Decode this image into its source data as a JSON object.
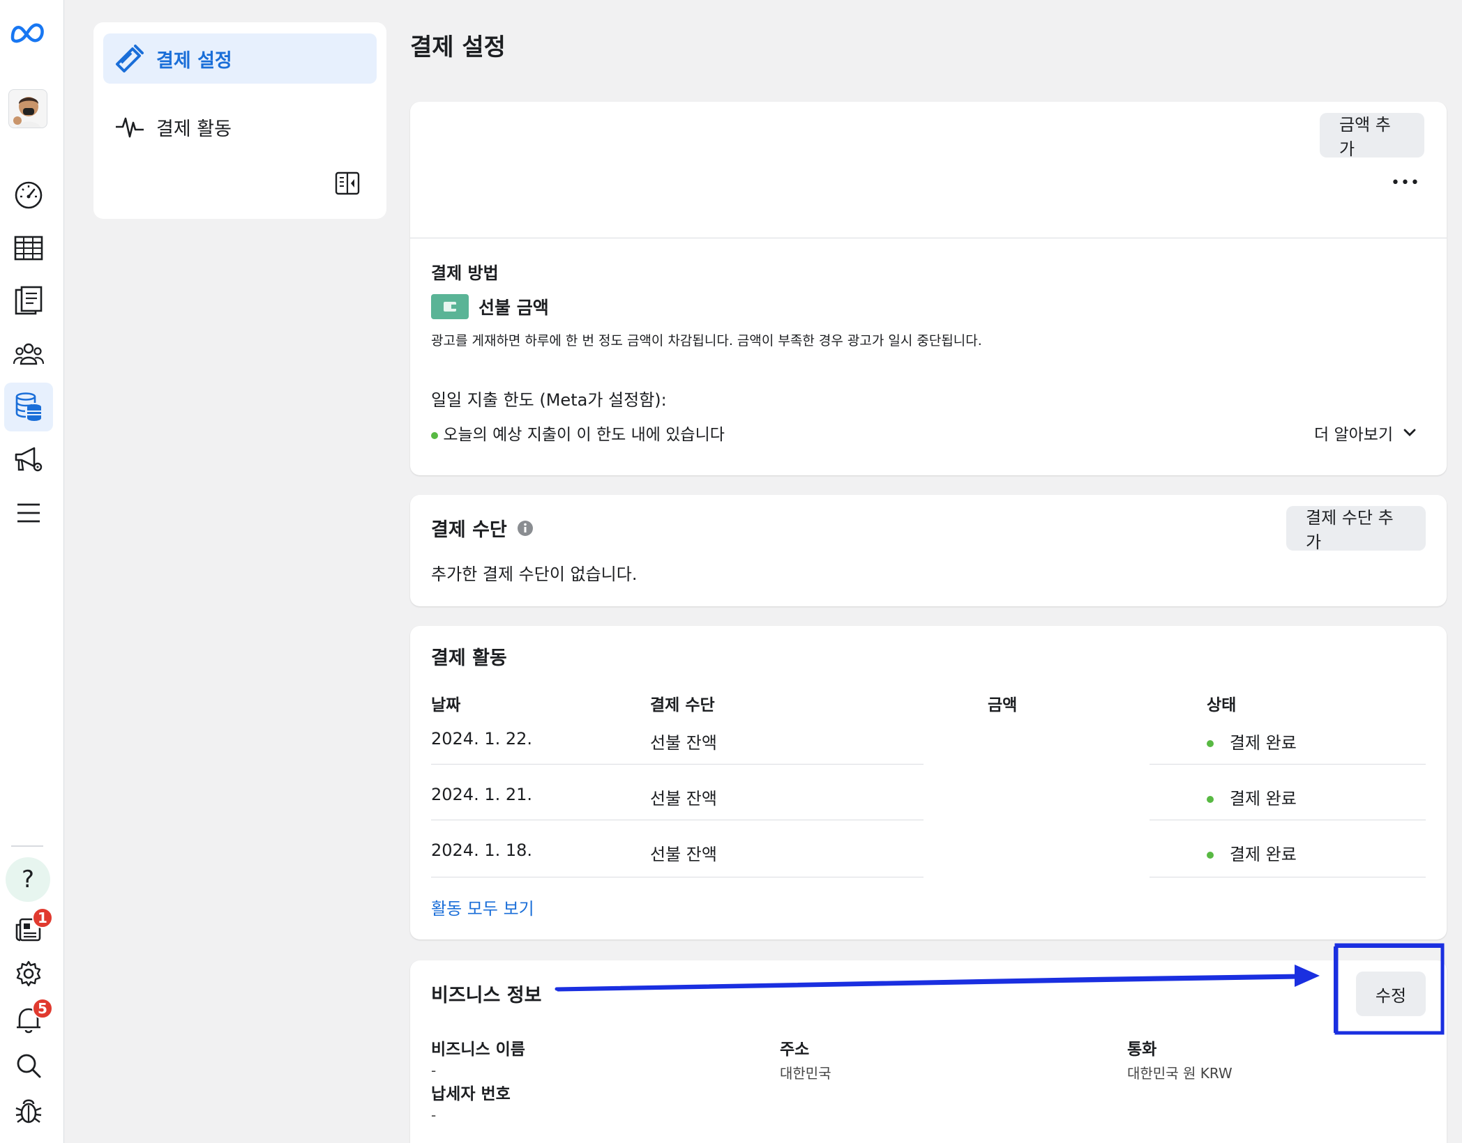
{
  "colors": {
    "accent": "#1a6ed8",
    "success": "#58b943",
    "badge": "#e03a2f",
    "annotation": "#1a2fe0"
  },
  "rail": {
    "items": [
      {
        "icon": "meta-logo-icon"
      },
      {
        "icon": "dashboard-gauge-icon"
      },
      {
        "icon": "table-icon"
      },
      {
        "icon": "pages-icon"
      },
      {
        "icon": "audience-icon"
      },
      {
        "icon": "billing-database-icon",
        "active": true
      },
      {
        "icon": "ads-manager-icon"
      },
      {
        "icon": "menu-icon"
      }
    ],
    "help_label": "?",
    "news_badge": "1",
    "notifications_badge": "5"
  },
  "subnav": {
    "items": [
      {
        "label": "결제 설정",
        "active": true
      },
      {
        "label": "결제 활동",
        "active": false
      }
    ]
  },
  "page": {
    "title": "결제 설정"
  },
  "balance_card": {
    "add_funds_label": "금액 추가",
    "more_label": "•••",
    "payment_method_title": "결제 방법",
    "method_name": "선불 금액",
    "method_desc": "광고를 게재하면 하루에 한 번 정도 금액이 차감됩니다. 금액이 부족한 경우 광고가 일시 중단됩니다.",
    "daily_limit_label": "일일 지출 한도 (Meta가 설정함):",
    "daily_limit_status": "오늘의 예상 지출이 이 한도 내에 있습니다",
    "learn_more_label": "더 알아보기"
  },
  "payment_methods_card": {
    "title": "결제 수단",
    "add_label": "결제 수단 추가",
    "empty_text": "추가한 결제 수단이 없습니다."
  },
  "activity_card": {
    "title": "결제 활동",
    "columns": {
      "date": "날짜",
      "method": "결제 수단",
      "amount": "금액",
      "status": "상태"
    },
    "rows": [
      {
        "date": "2024. 1. 22.",
        "method": "선불 잔액",
        "status": "결제 완료"
      },
      {
        "date": "2024. 1. 21.",
        "method": "선불 잔액",
        "status": "결제 완료"
      },
      {
        "date": "2024. 1. 18.",
        "method": "선불 잔액",
        "status": "결제 완료"
      }
    ],
    "view_all_label": "활동 모두 보기"
  },
  "business_card": {
    "title": "비즈니스 정보",
    "edit_label": "수정",
    "name_label": "비즈니스 이름",
    "name_value": "-",
    "address_label": "주소",
    "address_value": "대한민국",
    "currency_label": "통화",
    "currency_value": "대한민국 원 KRW",
    "tax_label": "납세자 번호",
    "tax_value": "-"
  }
}
